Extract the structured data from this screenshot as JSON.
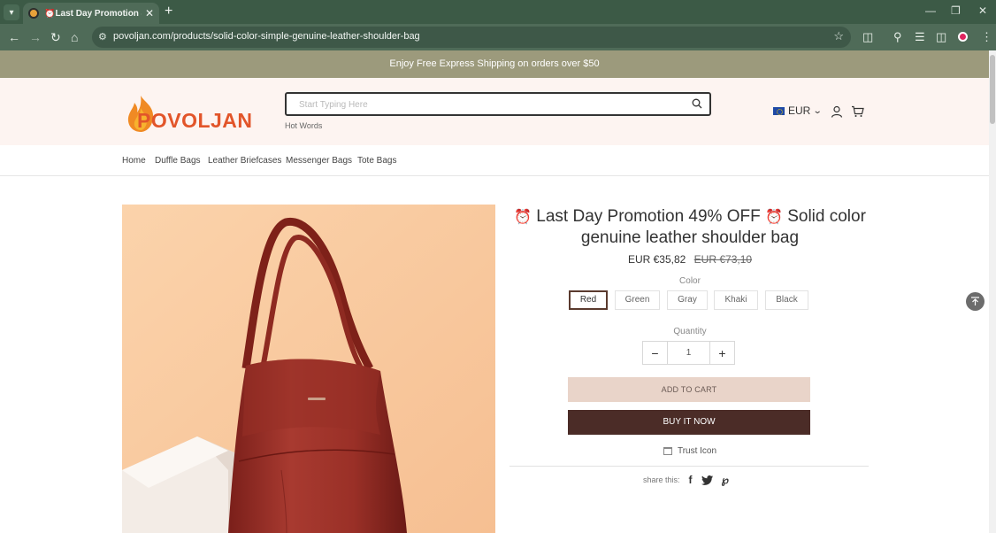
{
  "browser": {
    "tab_title": "⏰Last Day Promotion 49% O",
    "url": "povoljan.com/products/solid-color-simple-genuine-leather-shoulder-bag"
  },
  "announcement": "Enjoy Free Express Shipping on orders over $50",
  "header": {
    "logo_text": "POVOLJAN",
    "search_placeholder": "Start Typing Here",
    "hot_words": "Hot Words",
    "currency": "EUR"
  },
  "nav": [
    "Home",
    "Duffle Bags",
    "Leather Briefcases",
    "Messenger Bags",
    "Tote Bags"
  ],
  "product": {
    "title_line1": " Last Day Promotion 49% OFF ",
    "title_line1_suffix": " Solid color",
    "title_line2": "genuine leather shoulder bag",
    "price_now": "EUR €35,82",
    "price_was": "EUR €73,10",
    "color_label": "Color",
    "colors": [
      "Red",
      "Green",
      "Gray",
      "Khaki",
      "Black"
    ],
    "selected_color": "Red",
    "quantity_label": "Quantity",
    "quantity": "1",
    "add_to_cart": "ADD TO CART",
    "buy_now": "BUY IT NOW",
    "trust": "Trust Icon",
    "share_label": "share this:"
  },
  "colors": {
    "accent_dark": "#4b2c27",
    "accent_light": "#e9d4c9",
    "announce_bg": "#9c9a7c",
    "logo_orange": "#e2552a"
  }
}
